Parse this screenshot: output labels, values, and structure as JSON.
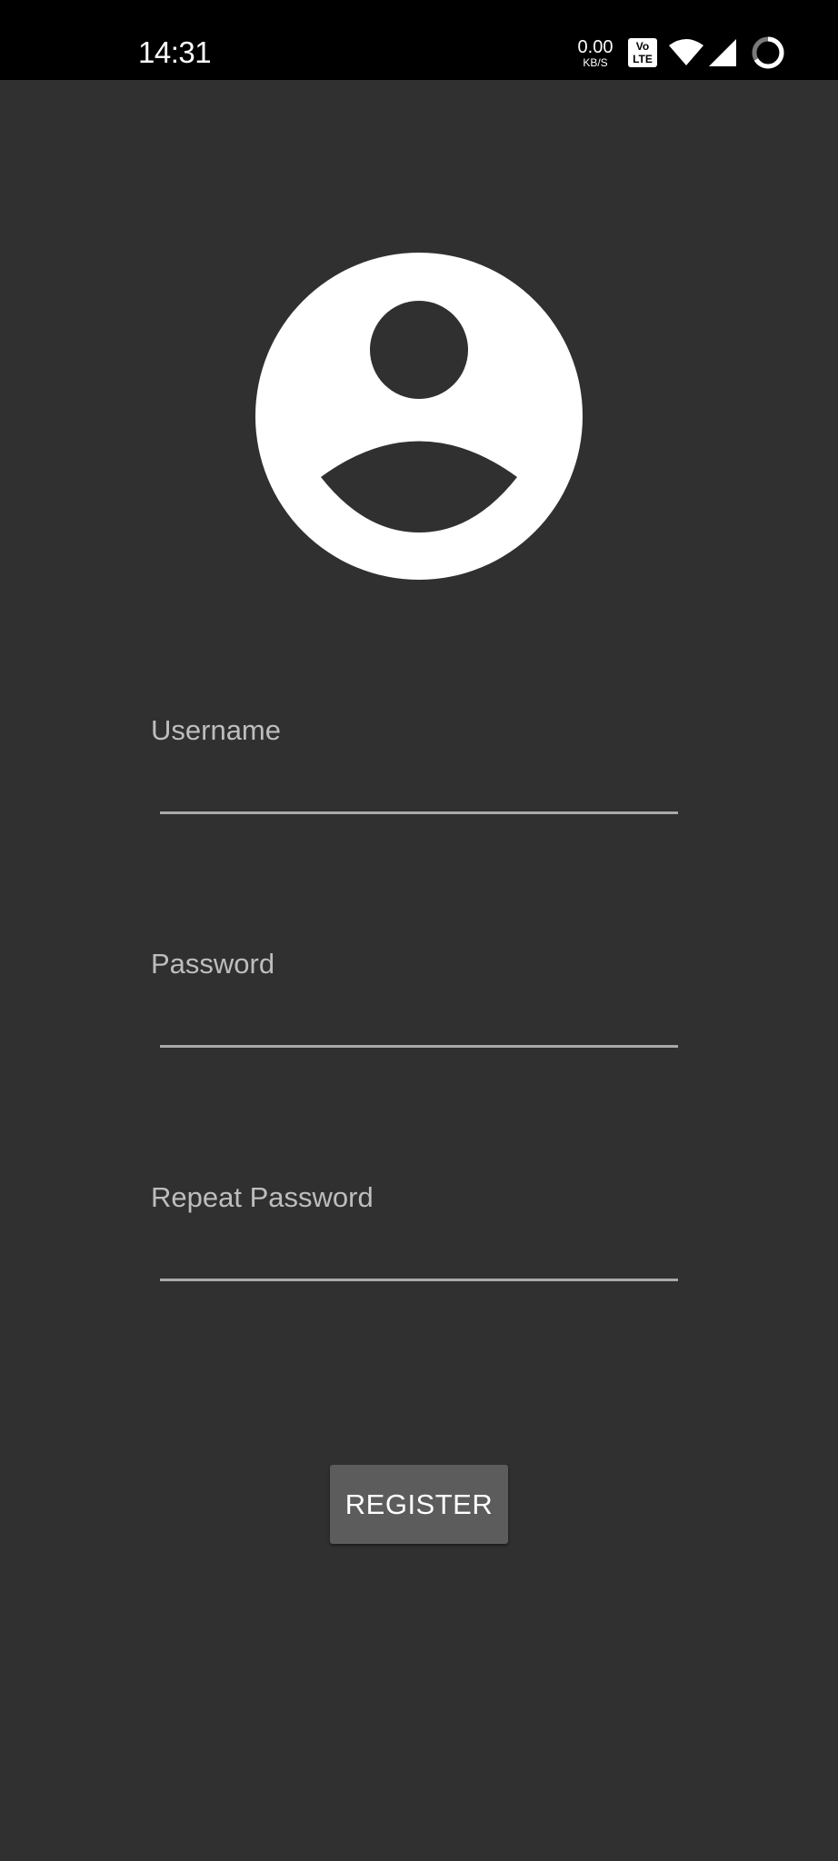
{
  "status_bar": {
    "time": "14:31",
    "net_speed_value": "0.00",
    "net_speed_unit": "KB/S",
    "volte_top": "Vo",
    "volte_bottom": "LTE",
    "icons": [
      "volte-icon",
      "wifi-icon",
      "cell-signal-icon",
      "battery-ring-icon"
    ]
  },
  "avatar": {
    "icon": "account-circle-icon",
    "color": "#ffffff"
  },
  "form": {
    "username": {
      "label": "Username",
      "value": ""
    },
    "password": {
      "label": "Password",
      "value": ""
    },
    "repeat_password": {
      "label": "Repeat Password",
      "value": ""
    }
  },
  "register_button": {
    "label": "REGISTER"
  },
  "colors": {
    "background": "#303030",
    "status_bar": "#000000",
    "label": "#bdbdbd",
    "underline": "#a9a9a9",
    "button": "#5c5c5c",
    "button_text": "#ffffff"
  }
}
